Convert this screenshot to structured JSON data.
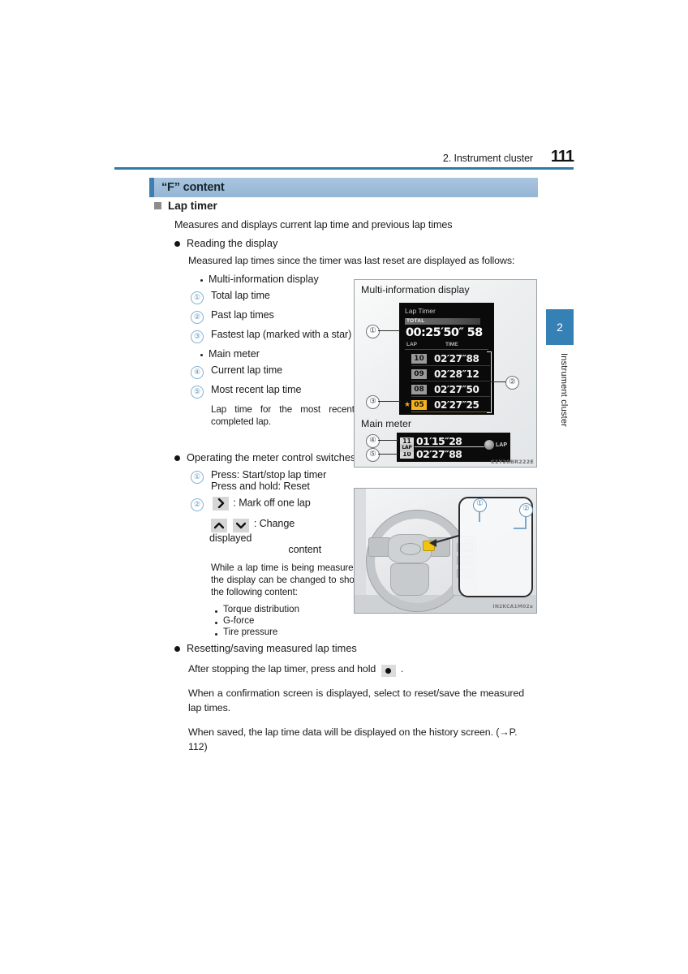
{
  "header": {
    "chapter": "2. Instrument cluster",
    "page_number": "111"
  },
  "side_tab": {
    "number": "2",
    "label": "Instrument cluster"
  },
  "section": {
    "band_title": "“F” content",
    "heading": "Lap timer",
    "lead": "Measures and displays current lap time and previous lap times"
  },
  "reading": {
    "heading": "Reading the display",
    "intro": "Measured lap times since the timer was last reset are displayed as follows:",
    "group_mid": "Multi-information display",
    "items_mid": [
      {
        "num": "①",
        "text": "Total lap time"
      },
      {
        "num": "②",
        "text": "Past lap times"
      },
      {
        "num": "③",
        "text": "Fastest lap (marked with a star)"
      }
    ],
    "group_main": "Main meter",
    "items_main": [
      {
        "num": "④",
        "text": "Current lap time"
      },
      {
        "num": "⑤",
        "text": "Most recent lap time"
      }
    ],
    "note": "Lap time for the most recently completed lap."
  },
  "operating": {
    "heading": "Operating the meter control switches",
    "item1_num": "①",
    "item1_line1": "Press: Start/stop lap timer",
    "item1_line2": "Press and hold: Reset",
    "item2_num": "②",
    "item2_icon": "chevron-right-icon",
    "item2_text": ": Mark off one lap",
    "item3_icon_up": "chevron-up-icon",
    "item3_icon_down": "chevron-down-icon",
    "item3_text": ":  Change   displayed",
    "item3_text2": "content",
    "note": "While a lap time is being measured, the display can be changed to show the following content:",
    "note_items": [
      "Torque distribution",
      "G-force",
      "Tire pressure"
    ]
  },
  "resetting": {
    "heading": "Resetting/saving measured lap times",
    "line1_before": "After stopping the lap timer, press and hold",
    "line1_icon": "round-button-icon",
    "line1_after": ".",
    "line2": "When a confirmation screen is displayed, select to reset/save the measured lap times.",
    "line3": "When saved, the lap time data will be displayed on the history screen. (→P. 112)"
  },
  "figure_mid": {
    "caption_top": "Multi-information display",
    "caption_bottom": "Main meter",
    "code": "C1Y20BR222E",
    "screen_title": "Lap Timer",
    "total_label": "TOTAL",
    "total_time": "00:25′50″ 58",
    "col_lap": "LAP",
    "col_time": "TIME",
    "rows": [
      {
        "star": "",
        "lap": "10",
        "time": "02′27″88"
      },
      {
        "star": "",
        "lap": "09",
        "time": "02′28″12"
      },
      {
        "star": "",
        "lap": "08",
        "time": "02′27″50"
      },
      {
        "star": "★",
        "lap": "05",
        "time": "02′27″25"
      }
    ],
    "main_rows": [
      {
        "badge": "11",
        "time": "01′15″28"
      },
      {
        "badge": "10",
        "time": "02′27″88"
      }
    ],
    "main_lap_badge": "LAP",
    "main_lap_icon_label": "LAP",
    "callouts": [
      "①",
      "②",
      "③",
      "④",
      "⑤"
    ]
  },
  "figure_wheel": {
    "code": "IN2KCA1M02a",
    "callouts": [
      "①",
      "②"
    ]
  },
  "colors": {
    "rule_blue": "#2e7aab",
    "band_blue": "#9dbcd9",
    "band_accent": "#3f7fb0",
    "tab_blue": "#3580b4",
    "callout_blue": "#5b93bb",
    "highlight_amber": "#f6b21b"
  }
}
